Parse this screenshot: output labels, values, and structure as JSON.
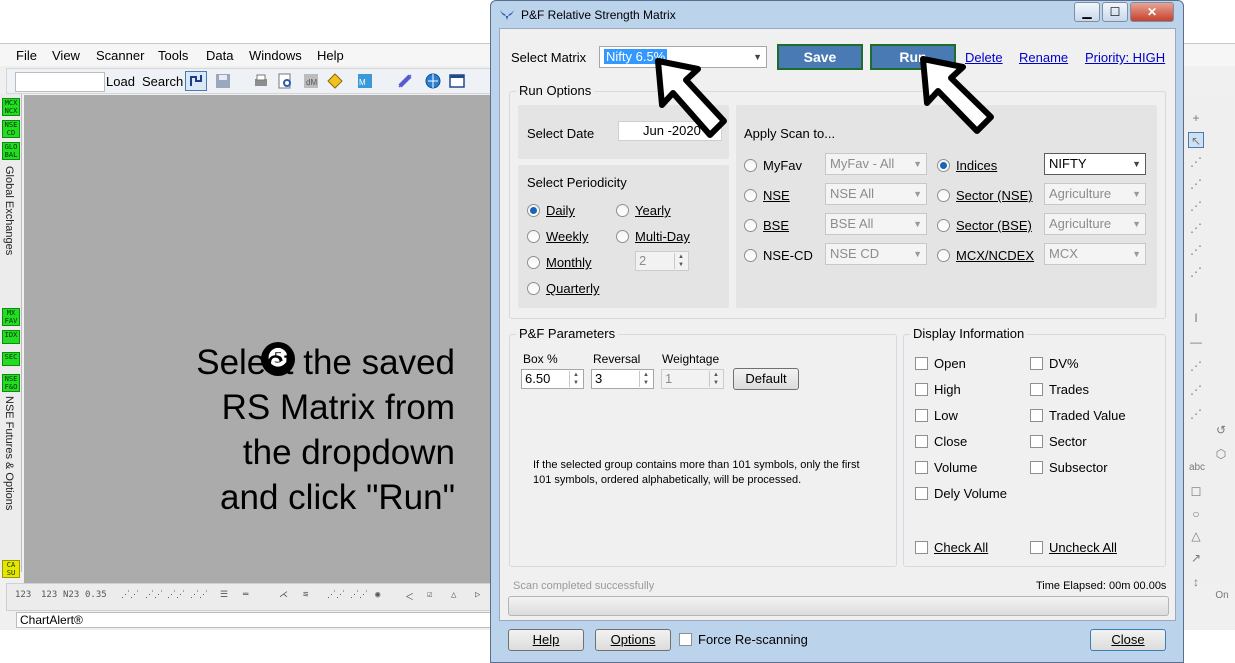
{
  "background_app": {
    "menu": [
      "File",
      "View",
      "Scanner",
      "Tools",
      "Data",
      "Windows",
      "Help"
    ],
    "toolbar": {
      "load_label": "Load",
      "search_label": "Search"
    },
    "left_tiles": [
      "MCX NCX",
      "NSE CD",
      "GLO BAL",
      "MX FAV",
      "IDX",
      "SEC",
      "NSE F&O",
      "CA SU"
    ],
    "left_vertical_labels": [
      "Global Exchanges",
      "NSE Futures & Options"
    ],
    "bottom_tools": [
      "123",
      "123",
      "N23",
      "0.35",
      "⋰⋰",
      "⋰⋰",
      "⋰⋰",
      "⋰⋰",
      "☰",
      "═",
      "⋌",
      "≋",
      "⋰⋰",
      "⋰⋰",
      "◉",
      "＜",
      "☑",
      "△",
      "▷"
    ],
    "status_text": "ChartAlert®",
    "right_tools": [
      "+",
      "↖",
      "⋰",
      "⋰",
      "⋰",
      "⋰",
      "⋰",
      "⋰",
      "I",
      "—",
      "⋰",
      "⋰",
      "⋰",
      "↺",
      "⬡",
      "abc",
      "☐",
      "○",
      "△",
      "↗",
      "↕",
      "On"
    ]
  },
  "instruction": {
    "step": "❺",
    "lines": [
      "Select the saved",
      "RS Matrix from",
      "the dropdown",
      "and click \"Run\""
    ]
  },
  "dialog": {
    "title": "P&F Relative Strength Matrix",
    "select_matrix_label": "Select Matrix",
    "select_matrix_value": "Nifty 6.5%",
    "save_label": "Save",
    "run_label": "Run",
    "links": {
      "delete": "Delete",
      "rename": "Rename",
      "priority": "Priority: HIGH"
    },
    "run_options_title": "Run Options",
    "select_date_label": "Select Date",
    "select_date_value": "Jun -2020",
    "periodicity_title": "Select Periodicity",
    "periodicity": [
      {
        "label": "Daily",
        "selected": true
      },
      {
        "label": "Weekly",
        "selected": false
      },
      {
        "label": "Monthly",
        "selected": false
      },
      {
        "label": "Quarterly",
        "selected": false
      },
      {
        "label": "Yearly",
        "selected": false
      },
      {
        "label": "Multi-Day",
        "selected": false
      }
    ],
    "multi_day_value": "2",
    "apply_scan_title": "Apply Scan to...",
    "scan_left": [
      {
        "label": "MyFav",
        "combo": "MyFav - All",
        "selected": false
      },
      {
        "label": "NSE",
        "combo": "NSE All",
        "selected": false
      },
      {
        "label": "BSE",
        "combo": "BSE All",
        "selected": false
      },
      {
        "label": "NSE-CD",
        "combo": "NSE CD",
        "selected": false
      }
    ],
    "scan_right": [
      {
        "label": "Indices",
        "combo": "NIFTY",
        "selected": true
      },
      {
        "label": "Sector (NSE)",
        "combo": "Agriculture",
        "selected": false
      },
      {
        "label": "Sector (BSE)",
        "combo": "Agriculture",
        "selected": false
      },
      {
        "label": "MCX/NCDEX",
        "combo": "MCX",
        "selected": false
      }
    ],
    "pf_title": "P&F Parameters",
    "pf": {
      "box_label": "Box %",
      "box_value": "6.50",
      "reversal_label": "Reversal",
      "reversal_value": "3",
      "weightage_label": "Weightage",
      "weightage_value": "1",
      "default_label": "Default"
    },
    "note": "If the selected group contains more than 101 symbols, only the first 101 symbols, ordered alphabetically, will be processed.",
    "display_title": "Display Information",
    "display_left": [
      "Open",
      "High",
      "Low",
      "Close",
      "Volume",
      "Dely Volume"
    ],
    "display_right": [
      "DV%",
      "Trades",
      "Traded Value",
      "Sector",
      "Subsector"
    ],
    "check_all_label": "Check All",
    "uncheck_all_label": "Uncheck All",
    "status_text": "Scan completed successfully",
    "elapsed_text": "Time Elapsed: 00m 00.00s",
    "help_label": "Help",
    "options_label": "Options",
    "force_rescan_label": "Force Re-scanning",
    "close_label": "Close"
  }
}
